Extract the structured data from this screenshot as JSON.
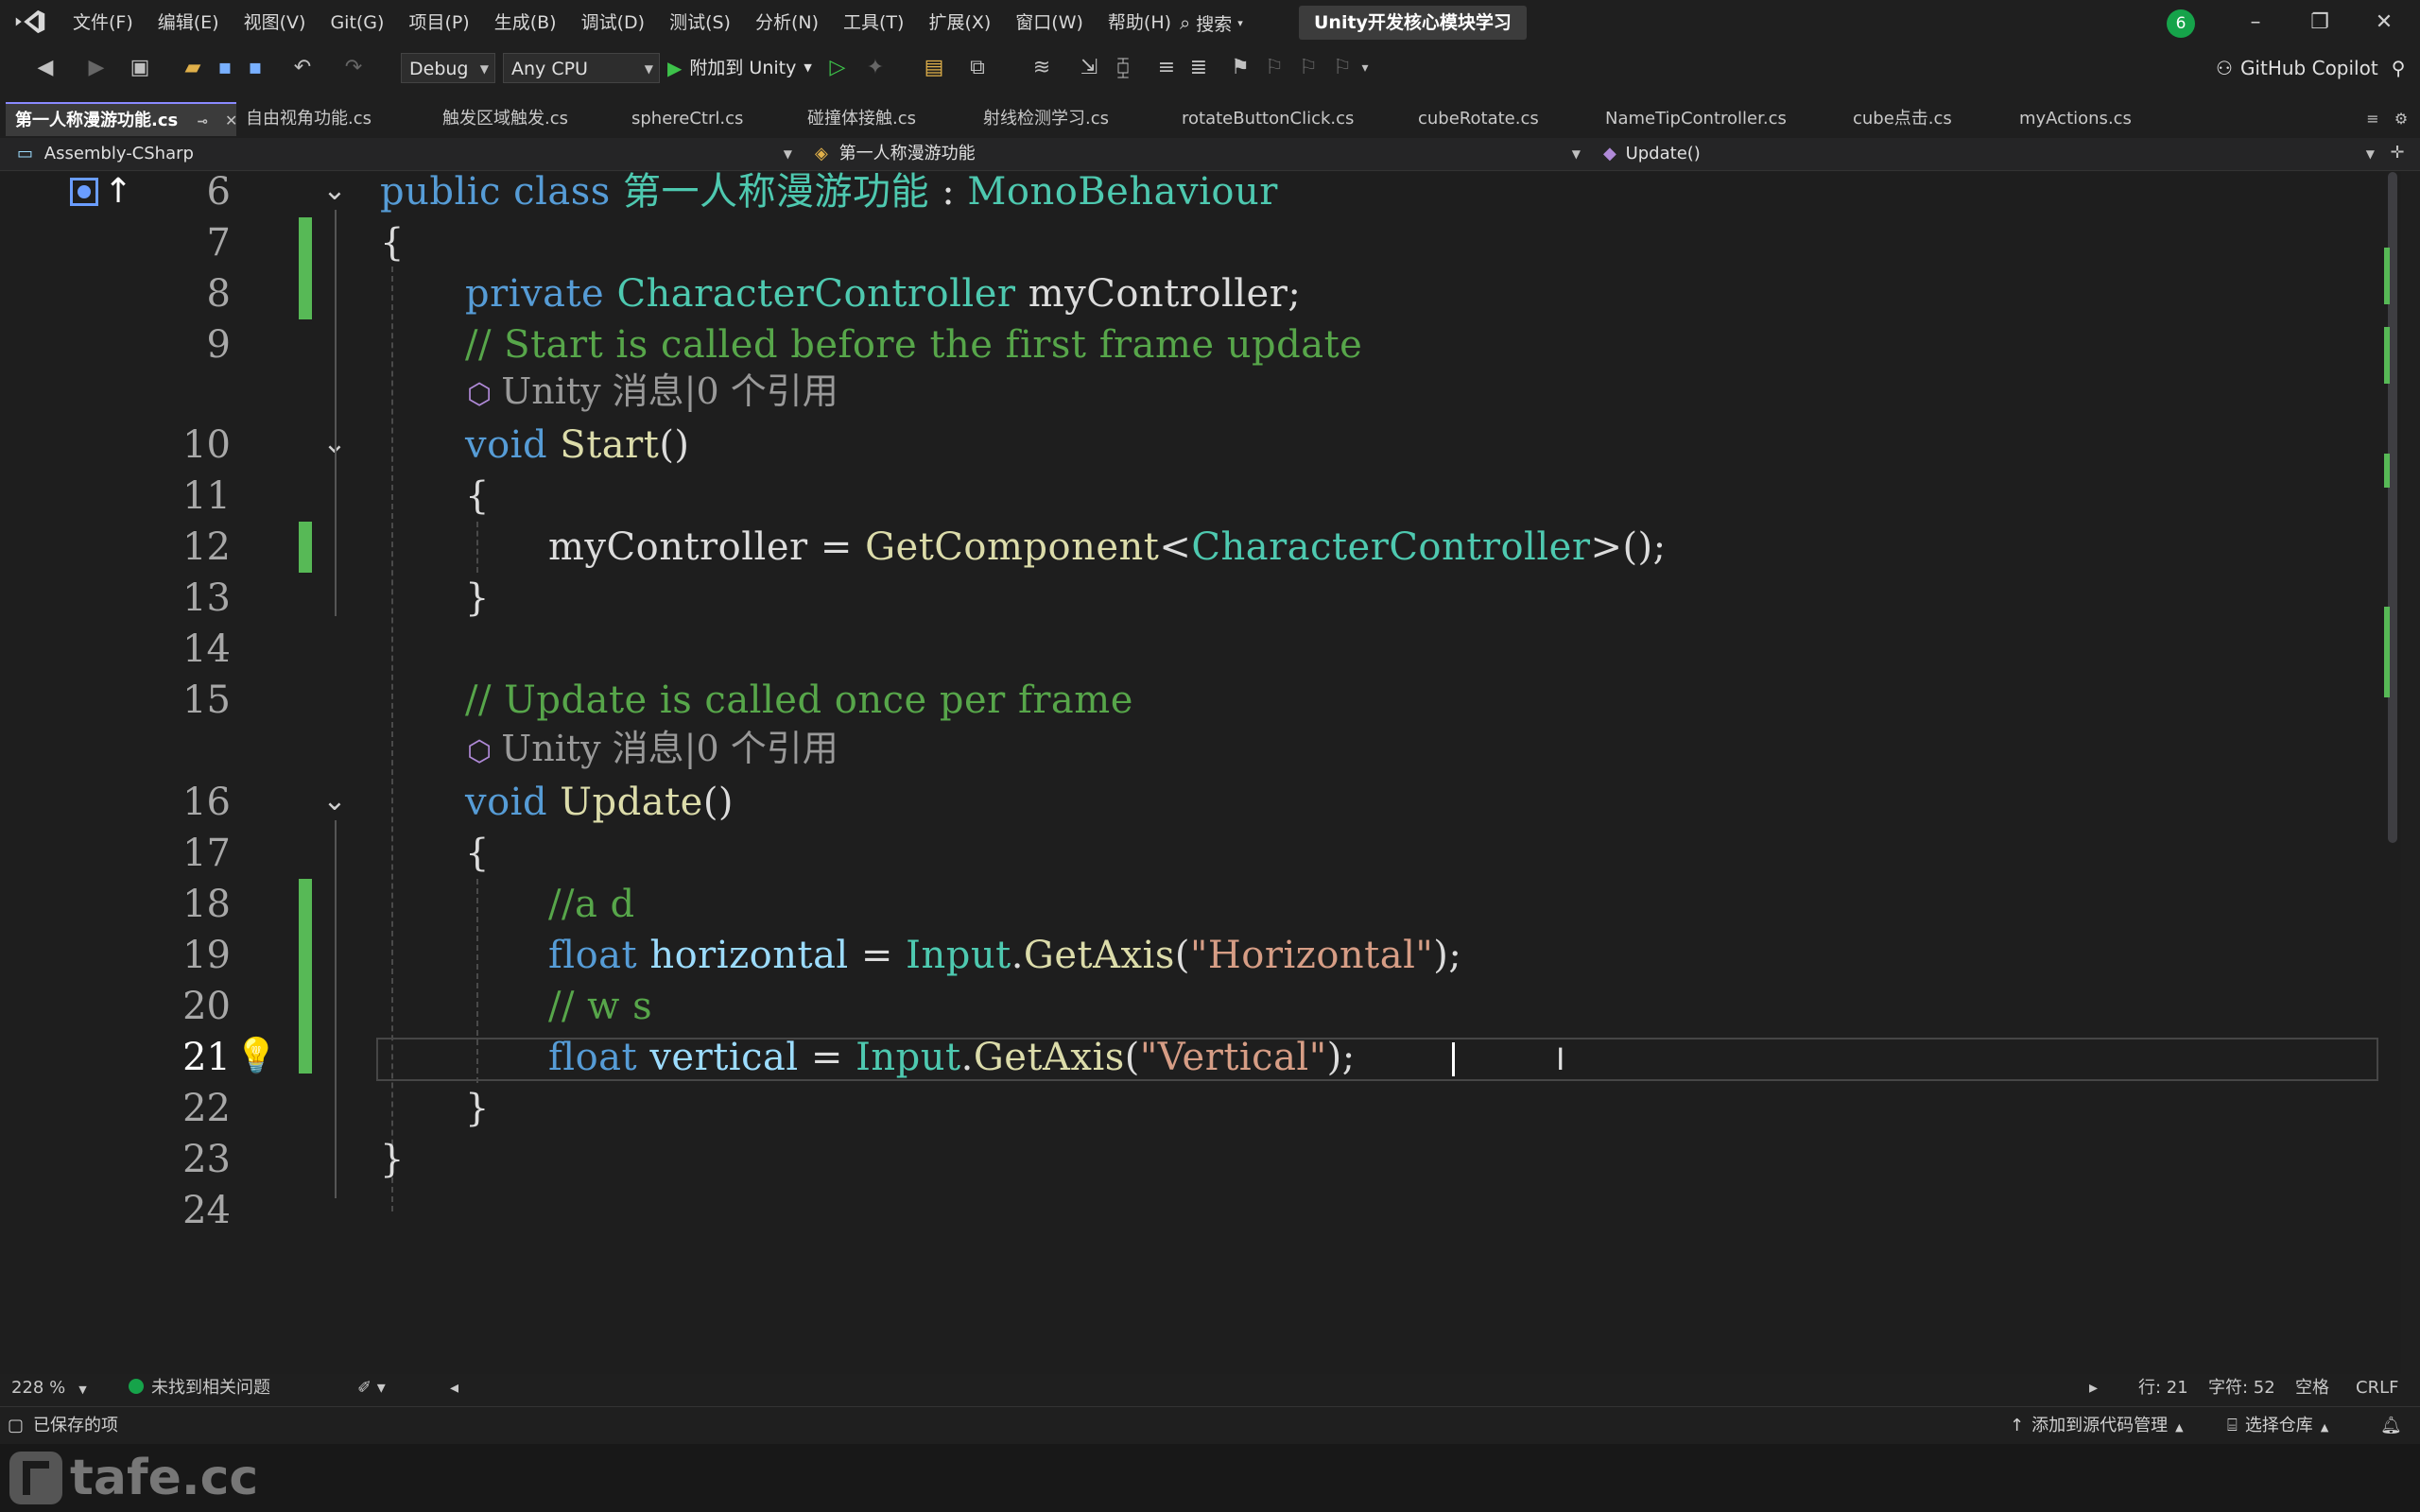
{
  "menubar": {
    "items": [
      "文件(F)",
      "编辑(E)",
      "视图(V)",
      "Git(G)",
      "项目(P)",
      "生成(B)",
      "调试(D)",
      "测试(S)",
      "分析(N)",
      "工具(T)",
      "扩展(X)",
      "窗口(W)",
      "帮助(H)"
    ],
    "search_label": "搜索",
    "solution_name": "Unity开发核心模块学习",
    "notification_count": "6",
    "window_controls": [
      "minimize-icon",
      "restore-icon",
      "close-icon"
    ]
  },
  "toolbar": {
    "config": "Debug",
    "platform": "Any CPU",
    "attach_label": "附加到 Unity",
    "copilot_label": "GitHub Copilot"
  },
  "tabs": [
    {
      "label": "第一人称漫游功能.cs",
      "active": true
    },
    {
      "label": "自由视角功能.cs"
    },
    {
      "label": "触发区域触发.cs"
    },
    {
      "label": "sphereCtrl.cs"
    },
    {
      "label": "碰撞体接触.cs"
    },
    {
      "label": "射线检测学习.cs"
    },
    {
      "label": "rotateButtonClick.cs"
    },
    {
      "label": "cubeRotate.cs"
    },
    {
      "label": "NameTipController.cs"
    },
    {
      "label": "cube点击.cs"
    },
    {
      "label": "myActions.cs"
    }
  ],
  "navbar": {
    "project": "Assembly-CSharp",
    "class": "第一人称漫游功能",
    "member": "Update()"
  },
  "editor": {
    "line_numbers": [
      "6",
      "7",
      "8",
      "9",
      "10",
      "11",
      "12",
      "13",
      "14",
      "15",
      "16",
      "17",
      "18",
      "19",
      "20",
      "21",
      "22",
      "23",
      "24"
    ],
    "current_line": "21",
    "codelens_1": "Unity 消息|0 个引用",
    "codelens_2": "Unity 消息|0 个引用",
    "code": {
      "l6_kw": "public class ",
      "l6_type": "第一人称漫游功能",
      "l6_sep": " : ",
      "l6_base": "MonoBehaviour",
      "l7": "{",
      "l8_kw": "private ",
      "l8_type": "CharacterController",
      "l8_rest": " myController;",
      "l9": "// Start is called before the first frame update",
      "l10_kw": "void ",
      "l10_fn": "Start",
      "l10_rest": "()",
      "l11": "{",
      "l12_a": "myController = ",
      "l12_fn": "GetComponent",
      "l12_lt": "<",
      "l12_type": "CharacterController",
      "l12_rest": ">();",
      "l13": "}",
      "l15": "// Update is called once per frame",
      "l16_kw": "void ",
      "l16_fn": "Update",
      "l16_rest": "()",
      "l17": "{",
      "l18": "//a d",
      "l19_kw": "float ",
      "l19_var": "horizontal",
      "l19_eq": " = ",
      "l19_type": "Input",
      "l19_dot": ".",
      "l19_fn": "GetAxis",
      "l19_p1": "(",
      "l19_str": "\"Horizontal\"",
      "l19_p2": ");",
      "l20": "// w s",
      "l21_kw": "float ",
      "l21_var": "vertical",
      "l21_eq": " = ",
      "l21_type": "Input",
      "l21_dot": ".",
      "l21_fn": "GetAxis",
      "l21_p1": "(",
      "l21_str": "\"Vertical\"",
      "l21_p2": ");",
      "l22": "}",
      "l23": "}"
    }
  },
  "editor_status": {
    "zoom": "228 %",
    "issues": "未找到相关问题",
    "line": "行: 21",
    "char": "字符: 52",
    "whitespace": "空格",
    "eol": "CRLF"
  },
  "statusbar": {
    "saved": "已保存的项",
    "source_control": "添加到源代码管理",
    "repo": "选择仓库"
  },
  "watermark": {
    "text": "tafe.cc"
  },
  "colors": {
    "keyword": "#569cd6",
    "type": "#4ec9b0",
    "comment": "#57a64a",
    "string": "#d69d85",
    "method": "#dcdcaa",
    "change_bar": "#57b956"
  }
}
